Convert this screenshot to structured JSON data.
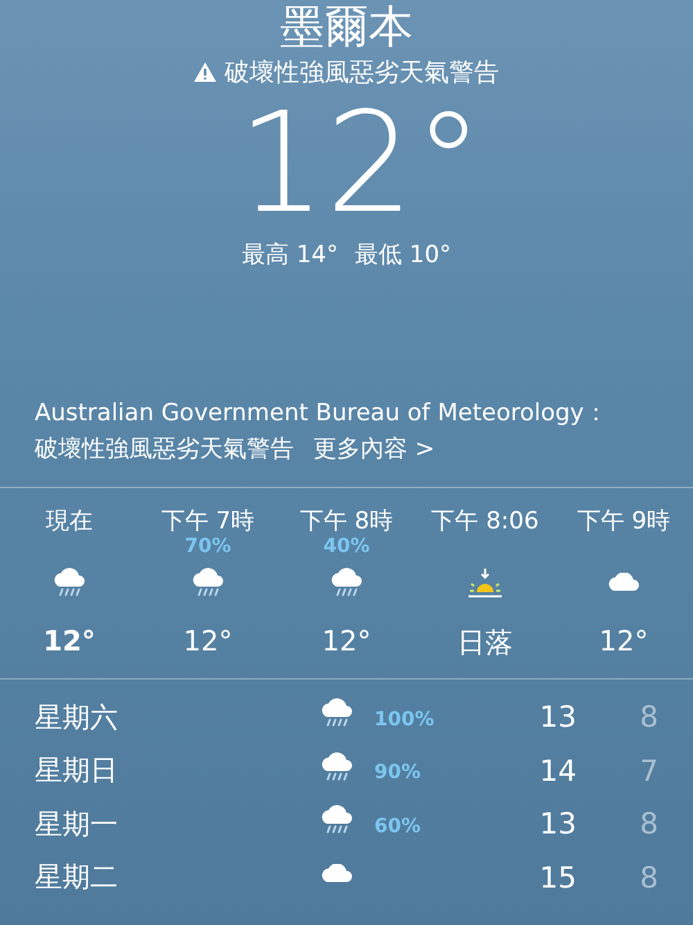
{
  "location": {
    "city": "墨爾本",
    "warning": "破壞性強風惡劣天氣警告"
  },
  "current": {
    "temperature": "12°",
    "high": "最高 14°",
    "low": "最低 10°"
  },
  "alert": {
    "source": "Australian Government Bureau of Meteorology：",
    "text": "破壞性強風惡劣天氣警告",
    "link": "更多內容 >"
  },
  "hourly": [
    {
      "time": "現在",
      "kind": "rain",
      "value": "12°",
      "bold": true
    },
    {
      "time": "下午 7時",
      "precip": "70%",
      "kind": "rain",
      "value": "12°",
      "bold": false
    },
    {
      "time": "下午 8時",
      "precip": "40%",
      "kind": "rain",
      "value": "12°",
      "bold": false
    },
    {
      "time": "下午 8:06",
      "kind": "sunset",
      "value": "日落",
      "bold": false
    },
    {
      "time": "下午 9時",
      "kind": "cloud",
      "value": "12°",
      "bold": false
    }
  ],
  "daily": [
    {
      "day": "星期六",
      "kind": "rain",
      "precip": "100%",
      "high": "13",
      "low": "8"
    },
    {
      "day": "星期日",
      "kind": "rain",
      "precip": "90%",
      "high": "14",
      "low": "7"
    },
    {
      "day": "星期一",
      "kind": "rain",
      "precip": "60%",
      "high": "13",
      "low": "8"
    },
    {
      "day": "星期二",
      "kind": "cloud",
      "high": "15",
      "low": "8"
    }
  ]
}
